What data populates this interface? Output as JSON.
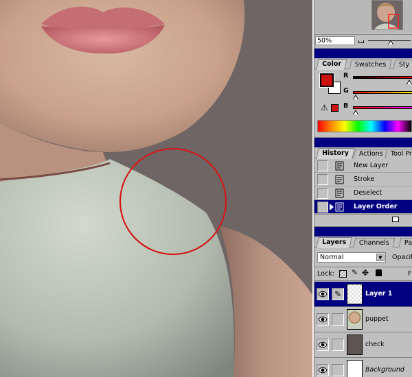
{
  "navigator": {
    "zoom": "50%"
  },
  "color_panel": {
    "tabs": [
      "Color",
      "Swatches",
      "Sty"
    ],
    "active_tab": "Color",
    "channels": [
      {
        "label": "R",
        "gradient": "linear-gradient(to right,#000,#ff0000)",
        "pos": 0.95
      },
      {
        "label": "G",
        "gradient": "linear-gradient(to right,#ff0000,#ffff00)",
        "pos": 0.05
      },
      {
        "label": "B",
        "gradient": "linear-gradient(to right,#ff0000,#ff00ff)",
        "pos": 0.05
      }
    ],
    "foreground_color": "#cc1111",
    "background_color": "#ffffff",
    "gamut_warning_icon": "warning-triangle-icon"
  },
  "history_panel": {
    "tabs": [
      "History",
      "Actions",
      "Tool Pr"
    ],
    "active_tab": "History",
    "items": [
      {
        "label": "New Layer",
        "icon": "history-state-icon",
        "selected": false
      },
      {
        "label": "Stroke",
        "icon": "history-state-icon",
        "selected": false
      },
      {
        "label": "Deselect",
        "icon": "history-state-icon",
        "selected": false
      },
      {
        "label": "Layer Order",
        "icon": "history-state-icon",
        "selected": true
      }
    ]
  },
  "layers_panel": {
    "tabs": [
      "Layers",
      "Channels",
      "Pa"
    ],
    "active_tab": "Layers",
    "blend_mode": "Normal",
    "opacity_label": "Opacit",
    "lock_label": "Lock:",
    "fill_label": "F",
    "layers": [
      {
        "name": "Layer 1",
        "selected": true,
        "italic": false,
        "thumb": "transparent"
      },
      {
        "name": "puppet",
        "selected": false,
        "italic": false,
        "thumb": "puppet"
      },
      {
        "name": "check",
        "selected": false,
        "italic": false,
        "thumb": "#5e5552"
      },
      {
        "name": "Background",
        "selected": false,
        "italic": true,
        "thumb": "#ffffff"
      }
    ]
  }
}
